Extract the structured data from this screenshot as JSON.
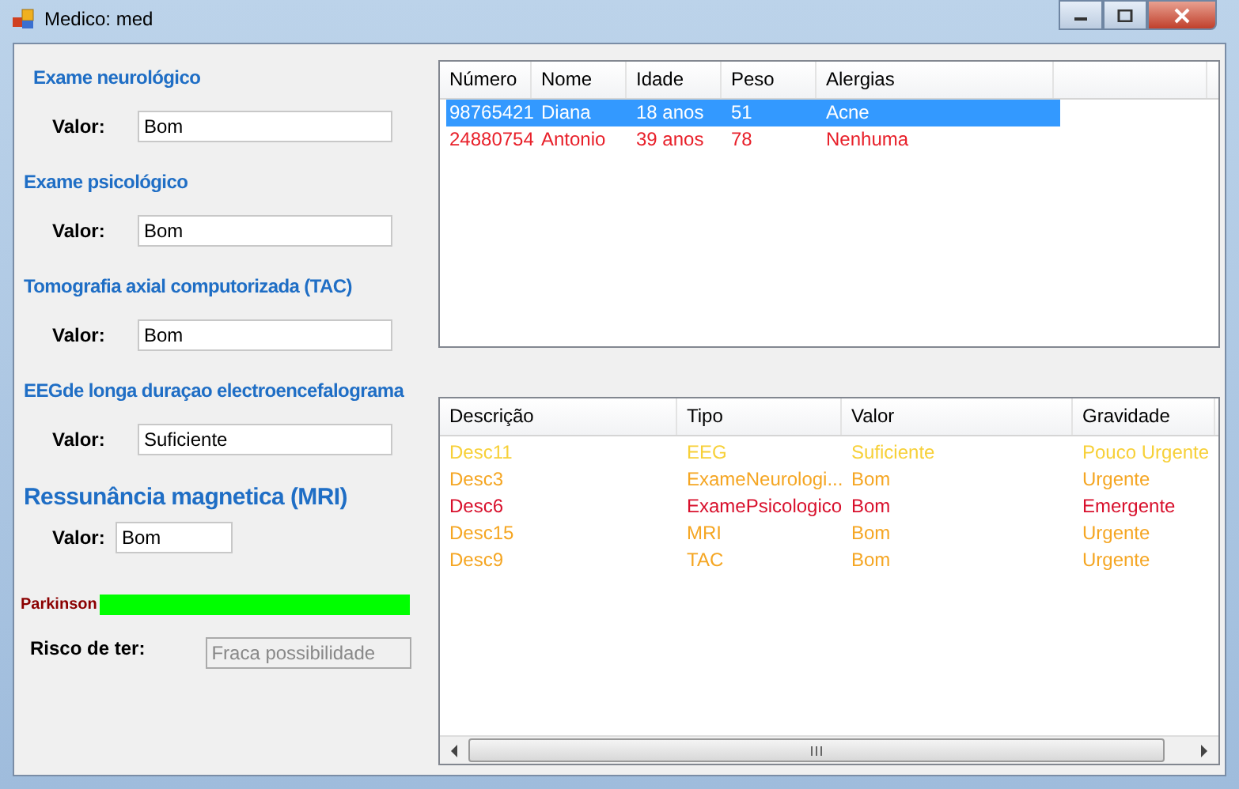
{
  "window": {
    "title": "Medico: med"
  },
  "exams": [
    {
      "heading": "Exame neurológico",
      "label": "Valor:",
      "value": "Bom",
      "kind": "wide"
    },
    {
      "heading": "Exame psicológico",
      "label": "Valor:",
      "value": "Bom",
      "kind": "wide"
    },
    {
      "heading": "Tomografia axial computorizada (TAC)",
      "label": "Valor:",
      "value": "Bom",
      "kind": "wide"
    },
    {
      "heading": "EEGde longa duraçao electroencefalograma",
      "label": "Valor:",
      "value": "Suficiente",
      "kind": "wide"
    },
    {
      "heading": "Ressunância magnetica (MRI)",
      "label": "Valor:",
      "value": "Bom",
      "kind": "narrow"
    }
  ],
  "disease": {
    "name": "Parkinson",
    "level": 1,
    "risk_label": "Risco de ter:",
    "risk_value": "Fraca possibilidade",
    "risk_disabled": true
  },
  "patients": {
    "columns": [
      "Número",
      "Nome",
      "Idade",
      "Peso",
      "Alergias"
    ],
    "rows": [
      {
        "cells": [
          "98765421",
          "Diana",
          "18 anos",
          "51",
          "Acne"
        ],
        "selected": true
      },
      {
        "cells": [
          "24880754",
          "Antonio",
          "39 anos",
          "78",
          "Nenhuma"
        ],
        "selected": false,
        "color": "#e8202a"
      }
    ]
  },
  "results": {
    "columns": [
      "Descrição",
      "Tipo",
      "Valor",
      "Gravidade"
    ],
    "rows": [
      {
        "cells": [
          "Desc11",
          "EEG",
          "Suficiente",
          "Pouco Urgente"
        ],
        "color": "#f7d038"
      },
      {
        "cells": [
          "Desc3",
          "ExameNeurologi...",
          "Bom",
          "Urgente"
        ],
        "color": "#f5a623"
      },
      {
        "cells": [
          "Desc6",
          "ExamePsicologico",
          "Bom",
          "Emergente"
        ],
        "color": "#d8102c"
      },
      {
        "cells": [
          "Desc15",
          "MRI",
          "Bom",
          "Urgente"
        ],
        "color": "#f5a623"
      },
      {
        "cells": [
          "Desc9",
          "TAC",
          "Bom",
          "Urgente"
        ],
        "color": "#f5a623"
      }
    ]
  }
}
